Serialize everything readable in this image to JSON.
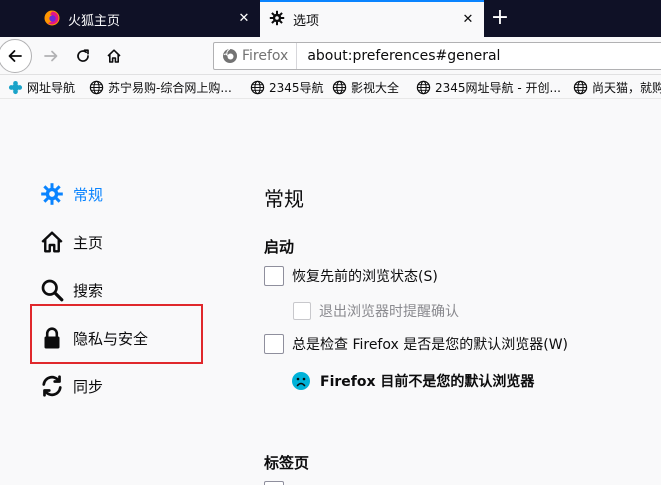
{
  "tabs": [
    {
      "title": "火狐主页",
      "active": false
    },
    {
      "title": "选项",
      "active": true
    }
  ],
  "navbar": {
    "identity_label": "Firefox",
    "url": "about:preferences#general"
  },
  "bookmarks": [
    {
      "label": "网址导航",
      "icon": "puzzle-icon"
    },
    {
      "label": "苏宁易购-综合网上购...",
      "icon": "globe-icon"
    },
    {
      "label": "2345导航",
      "icon": "globe-icon"
    },
    {
      "label": "影视大全",
      "icon": "globe-icon"
    },
    {
      "label": "2345网址导航 - 开创...",
      "icon": "globe-icon"
    },
    {
      "label": "尚天猫，就购",
      "icon": "globe-icon"
    }
  ],
  "sidebar": {
    "items": [
      {
        "label": "常规",
        "icon": "gear-icon",
        "selected": true
      },
      {
        "label": "主页",
        "icon": "home-icon",
        "selected": false
      },
      {
        "label": "搜索",
        "icon": "search-icon",
        "selected": false
      },
      {
        "label": "隐私与安全",
        "icon": "lock-icon",
        "selected": false
      },
      {
        "label": "同步",
        "icon": "sync-icon",
        "selected": false
      }
    ]
  },
  "main": {
    "title": "常规",
    "startup": {
      "title": "启动",
      "restore_session": "恢复先前的浏览状态(S)",
      "warn_on_quit": "退出浏览器时提醒确认",
      "check_default": "总是检查 Firefox 是否是您的默认浏览器(W)",
      "not_default_notice": "Firefox 目前不是您的默认浏览器"
    },
    "tabs_section": {
      "title": "标签页"
    }
  },
  "colors": {
    "accent": "#0a84ff",
    "tabstrip": "#0f1126",
    "highlight": "#e0282c"
  }
}
